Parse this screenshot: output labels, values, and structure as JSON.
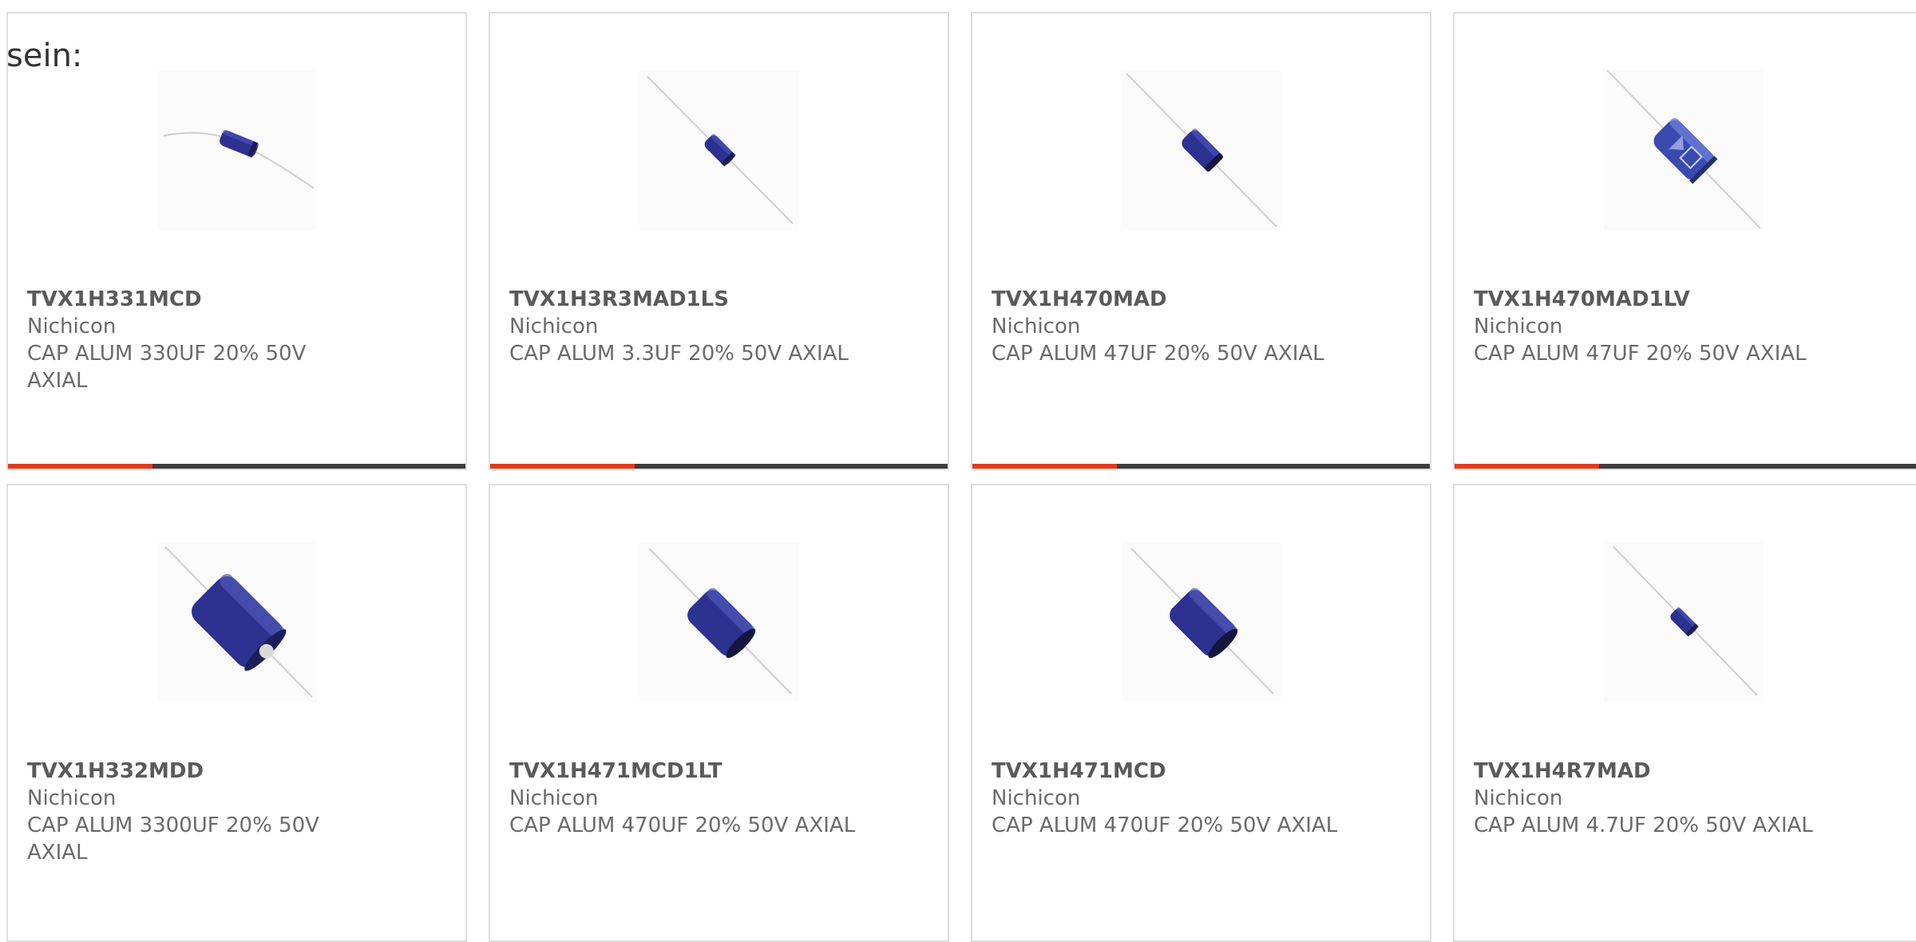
{
  "intro_text": "sein:",
  "products": [
    {
      "part": "TVX1H331MCD",
      "maker": "Nichicon",
      "desc": "CAP ALUM 330UF 20% 50V AXIAL",
      "image": "axial-capacitor-small-icon"
    },
    {
      "part": "TVX1H3R3MAD1LS",
      "maker": "Nichicon",
      "desc": "CAP ALUM 3.3UF 20% 50V AXIAL",
      "image": "axial-capacitor-small-icon"
    },
    {
      "part": "TVX1H470MAD",
      "maker": "Nichicon",
      "desc": "CAP ALUM 47UF 20% 50V AXIAL",
      "image": "axial-capacitor-small-icon"
    },
    {
      "part": "TVX1H470MAD1LV",
      "maker": "Nichicon",
      "desc": "CAP ALUM 47UF 20% 50V AXIAL",
      "image": "axial-capacitor-sleeved-icon"
    },
    {
      "part": "TVX1H332MDD",
      "maker": "Nichicon",
      "desc": "CAP ALUM 3300UF 20% 50V AXIAL",
      "image": "axial-capacitor-large-icon"
    },
    {
      "part": "TVX1H471MCD1LT",
      "maker": "Nichicon",
      "desc": "CAP ALUM 470UF 20% 50V AXIAL",
      "image": "axial-capacitor-medium-icon"
    },
    {
      "part": "TVX1H471MCD",
      "maker": "Nichicon",
      "desc": "CAP ALUM 470UF 20% 50V AXIAL",
      "image": "axial-capacitor-medium-icon"
    },
    {
      "part": "TVX1H4R7MAD",
      "maker": "Nichicon",
      "desc": "CAP ALUM 4.7UF 20% 50V AXIAL",
      "image": "axial-capacitor-small-icon"
    }
  ],
  "colors": {
    "accent": "#e43b1a",
    "bar": "#3d3d3d",
    "capacitor_body": "#2b2f8f"
  }
}
